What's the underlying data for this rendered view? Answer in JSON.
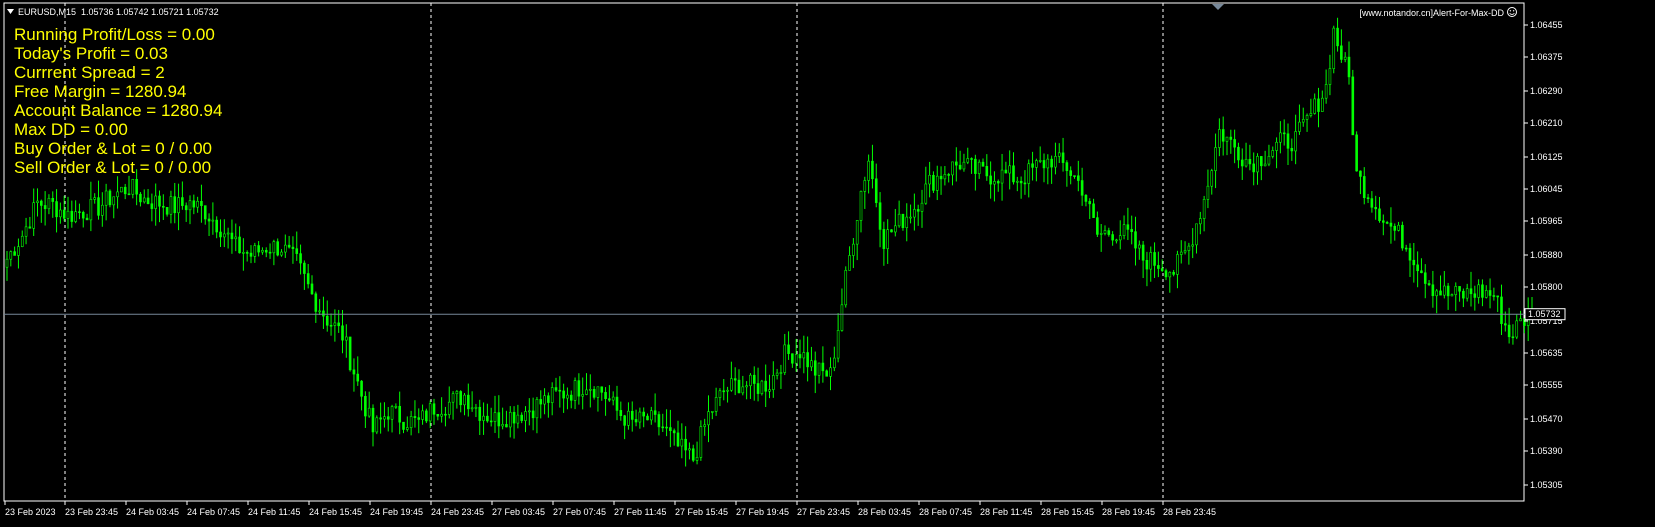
{
  "symbol_header": {
    "symbol": "EURUSD,M15",
    "quotes": "1.05736 1.05742 1.05721 1.05732",
    "menu_icon": "triangle-down-icon"
  },
  "indicator_label": "[www.notandor.cn]Alert-For-Max-DD",
  "indicator_icon": "smiley-icon",
  "info_panel": [
    "Running Profit/Loss = 0.00",
    "Today's Profit = 0.03",
    "Currrent Spread = 2",
    "Free Margin = 1280.94",
    "Account Balance = 1280.94",
    "Max DD = 0.00",
    "Buy Order & Lot = 0 / 0.00",
    "Sell Order & Lot = 0 / 0.00"
  ],
  "colors": {
    "background": "#000000",
    "bull_candle": "#00ff00",
    "bear_candle": "#00ff00",
    "info_text": "#ffff00",
    "grid_separator": "#ffffff",
    "price_line": "#778899",
    "axis": "#ffffff"
  },
  "chart_data": {
    "type": "candlestick",
    "timeframe": "M15",
    "current_price": "1.05732",
    "ylim": [
      1.05265,
      1.0651
    ],
    "y_ticks": [
      "1.06455",
      "1.06375",
      "1.06290",
      "1.06210",
      "1.06125",
      "1.06045",
      "1.05965",
      "1.05880",
      "1.05800",
      "1.05715",
      "1.05635",
      "1.05555",
      "1.05470",
      "1.05390",
      "1.05305"
    ],
    "x_ticks": [
      "23 Feb 2023",
      "23 Feb 23:45",
      "24 Feb 03:45",
      "24 Feb 07:45",
      "24 Feb 11:45",
      "24 Feb 15:45",
      "24 Feb 19:45",
      "24 Feb 23:45",
      "27 Feb 03:45",
      "27 Feb 07:45",
      "27 Feb 11:45",
      "27 Feb 15:45",
      "27 Feb 19:45",
      "27 Feb 23:45",
      "28 Feb 03:45",
      "28 Feb 07:45",
      "28 Feb 11:45",
      "28 Feb 15:45",
      "28 Feb 19:45",
      "28 Feb 23:45"
    ],
    "day_separators": [
      "23 Feb 23:45",
      "24 Feb 23:45",
      "27 Feb 23:45",
      "28 Feb 23:45"
    ],
    "bars_per_tick": 16,
    "close_path": [
      [
        0,
        1.0587
      ],
      [
        4,
        1.0593
      ],
      [
        8,
        1.0601
      ],
      [
        12,
        1.06005
      ],
      [
        16,
        1.0598
      ],
      [
        20,
        1.0599
      ],
      [
        24,
        1.06
      ],
      [
        28,
        1.0603
      ],
      [
        32,
        1.0605
      ],
      [
        36,
        1.0602
      ],
      [
        40,
        1.0601
      ],
      [
        44,
        1.06
      ],
      [
        48,
        1.0601
      ],
      [
        52,
        1.0599
      ],
      [
        56,
        1.0595
      ],
      [
        60,
        1.059
      ],
      [
        64,
        1.0588
      ],
      [
        68,
        1.059
      ],
      [
        72,
        1.059
      ],
      [
        76,
        1.0586
      ],
      [
        80,
        1.0578
      ],
      [
        84,
        1.0572
      ],
      [
        88,
        1.0568
      ],
      [
        92,
        1.0556
      ],
      [
        96,
        1.0544
      ],
      [
        100,
        1.0549
      ],
      [
        104,
        1.0547
      ],
      [
        108,
        1.0546
      ],
      [
        112,
        1.055
      ],
      [
        116,
        1.0551
      ],
      [
        120,
        1.0553
      ],
      [
        124,
        1.0549
      ],
      [
        128,
        1.0547
      ],
      [
        132,
        1.0548
      ],
      [
        136,
        1.0549
      ],
      [
        140,
        1.0551
      ],
      [
        144,
        1.0553
      ],
      [
        148,
        1.0554
      ],
      [
        152,
        1.0556
      ],
      [
        156,
        1.0554
      ],
      [
        160,
        1.0549
      ],
      [
        164,
        1.0546
      ],
      [
        168,
        1.0547
      ],
      [
        172,
        1.0545
      ],
      [
        176,
        1.054
      ],
      [
        180,
        1.0537
      ],
      [
        184,
        1.0548
      ],
      [
        188,
        1.0554
      ],
      [
        192,
        1.0556
      ],
      [
        196,
        1.0555
      ],
      [
        200,
        1.0556
      ],
      [
        204,
        1.0563
      ],
      [
        208,
        1.0564
      ],
      [
        212,
        1.0559
      ],
      [
        216,
        1.0558
      ],
      [
        220,
        1.0582
      ],
      [
        224,
        1.0604
      ],
      [
        226,
        1.0612
      ],
      [
        230,
        1.0592
      ],
      [
        234,
        1.0596
      ],
      [
        238,
        1.06
      ],
      [
        242,
        1.0606
      ],
      [
        246,
        1.0609
      ],
      [
        250,
        1.0611
      ],
      [
        254,
        1.0609
      ],
      [
        258,
        1.0608
      ],
      [
        262,
        1.0608
      ],
      [
        266,
        1.0607
      ],
      [
        270,
        1.061
      ],
      [
        274,
        1.0612
      ],
      [
        278,
        1.061
      ],
      [
        282,
        1.0605
      ],
      [
        286,
        1.0593
      ],
      [
        290,
        1.0594
      ],
      [
        294,
        1.0593
      ],
      [
        298,
        1.0587
      ],
      [
        302,
        1.0586
      ],
      [
        306,
        1.0584
      ],
      [
        310,
        1.059
      ],
      [
        314,
        1.0602
      ],
      [
        318,
        1.0619
      ],
      [
        322,
        1.0615
      ],
      [
        326,
        1.0611
      ],
      [
        330,
        1.0613
      ],
      [
        334,
        1.0616
      ],
      [
        338,
        1.0617
      ],
      [
        342,
        1.0623
      ],
      [
        346,
        1.063
      ],
      [
        348,
        1.0644
      ],
      [
        352,
        1.0632
      ],
      [
        354,
        1.0608
      ],
      [
        358,
        1.0602
      ],
      [
        362,
        1.0596
      ],
      [
        366,
        1.0592
      ],
      [
        370,
        1.0586
      ],
      [
        374,
        1.058
      ],
      [
        378,
        1.0578
      ],
      [
        382,
        1.0578
      ],
      [
        386,
        1.0579
      ],
      [
        390,
        1.0578
      ],
      [
        394,
        1.0568
      ],
      [
        398,
        1.0572
      ],
      [
        400,
        1.05732
      ]
    ]
  }
}
